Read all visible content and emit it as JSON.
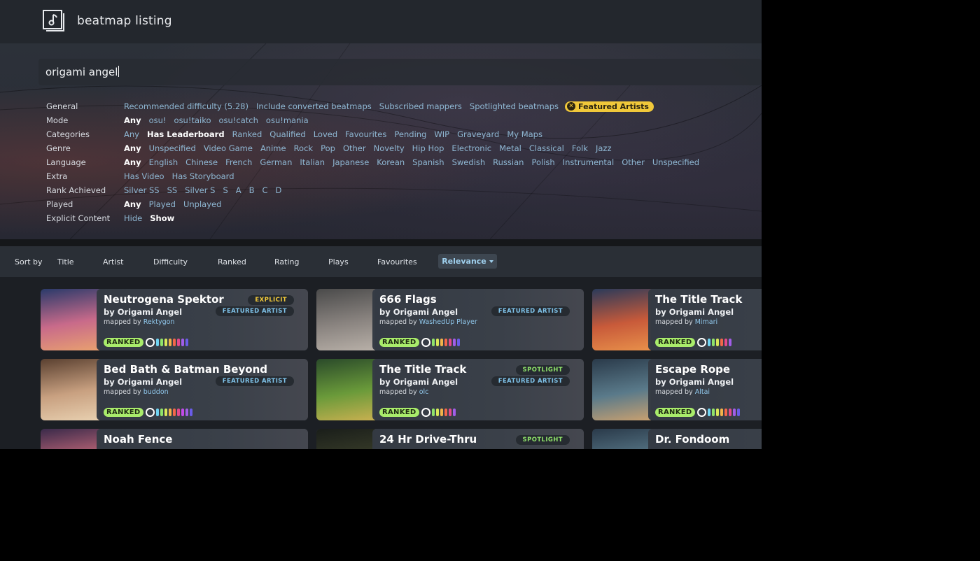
{
  "header": {
    "title": "beatmap listing",
    "logo_icon": "music-note-icon"
  },
  "search": {
    "value": "origami angel"
  },
  "filters": [
    {
      "label": "General",
      "options": [
        {
          "text": "Recommended difficulty (5.28)",
          "active": false
        },
        {
          "text": "Include converted beatmaps",
          "active": false
        },
        {
          "text": "Subscribed mappers",
          "active": false
        },
        {
          "text": "Spotlighted beatmaps",
          "active": false
        }
      ],
      "pill": "Featured Artists"
    },
    {
      "label": "Mode",
      "options": [
        {
          "text": "Any",
          "active": true
        },
        {
          "text": "osu!",
          "active": false
        },
        {
          "text": "osu!taiko",
          "active": false
        },
        {
          "text": "osu!catch",
          "active": false
        },
        {
          "text": "osu!mania",
          "active": false
        }
      ]
    },
    {
      "label": "Categories",
      "options": [
        {
          "text": "Any",
          "active": false
        },
        {
          "text": "Has Leaderboard",
          "active": true
        },
        {
          "text": "Ranked",
          "active": false
        },
        {
          "text": "Qualified",
          "active": false
        },
        {
          "text": "Loved",
          "active": false
        },
        {
          "text": "Favourites",
          "active": false
        },
        {
          "text": "Pending",
          "active": false
        },
        {
          "text": "WIP",
          "active": false
        },
        {
          "text": "Graveyard",
          "active": false
        },
        {
          "text": "My Maps",
          "active": false
        }
      ]
    },
    {
      "label": "Genre",
      "options": [
        {
          "text": "Any",
          "active": true
        },
        {
          "text": "Unspecified",
          "active": false
        },
        {
          "text": "Video Game",
          "active": false
        },
        {
          "text": "Anime",
          "active": false
        },
        {
          "text": "Rock",
          "active": false
        },
        {
          "text": "Pop",
          "active": false
        },
        {
          "text": "Other",
          "active": false
        },
        {
          "text": "Novelty",
          "active": false
        },
        {
          "text": "Hip Hop",
          "active": false
        },
        {
          "text": "Electronic",
          "active": false
        },
        {
          "text": "Metal",
          "active": false
        },
        {
          "text": "Classical",
          "active": false
        },
        {
          "text": "Folk",
          "active": false
        },
        {
          "text": "Jazz",
          "active": false
        }
      ]
    },
    {
      "label": "Language",
      "options": [
        {
          "text": "Any",
          "active": true
        },
        {
          "text": "English",
          "active": false
        },
        {
          "text": "Chinese",
          "active": false
        },
        {
          "text": "French",
          "active": false
        },
        {
          "text": "German",
          "active": false
        },
        {
          "text": "Italian",
          "active": false
        },
        {
          "text": "Japanese",
          "active": false
        },
        {
          "text": "Korean",
          "active": false
        },
        {
          "text": "Spanish",
          "active": false
        },
        {
          "text": "Swedish",
          "active": false
        },
        {
          "text": "Russian",
          "active": false
        },
        {
          "text": "Polish",
          "active": false
        },
        {
          "text": "Instrumental",
          "active": false
        },
        {
          "text": "Other",
          "active": false
        },
        {
          "text": "Unspecified",
          "active": false
        }
      ]
    },
    {
      "label": "Extra",
      "options": [
        {
          "text": "Has Video",
          "active": false
        },
        {
          "text": "Has Storyboard",
          "active": false
        }
      ]
    },
    {
      "label": "Rank Achieved",
      "options": [
        {
          "text": "Silver SS",
          "active": false
        },
        {
          "text": "SS",
          "active": false
        },
        {
          "text": "Silver S",
          "active": false
        },
        {
          "text": "S",
          "active": false
        },
        {
          "text": "A",
          "active": false
        },
        {
          "text": "B",
          "active": false
        },
        {
          "text": "C",
          "active": false
        },
        {
          "text": "D",
          "active": false
        }
      ]
    },
    {
      "label": "Played",
      "options": [
        {
          "text": "Any",
          "active": true
        },
        {
          "text": "Played",
          "active": false
        },
        {
          "text": "Unplayed",
          "active": false
        }
      ]
    },
    {
      "label": "Explicit Content",
      "options": [
        {
          "text": "Hide",
          "active": false
        },
        {
          "text": "Show",
          "active": true
        }
      ]
    }
  ],
  "sort": {
    "label": "Sort by",
    "options": [
      "Title",
      "Artist",
      "Difficulty",
      "Ranked",
      "Rating",
      "Plays",
      "Favourites"
    ],
    "active": "Relevance"
  },
  "cards": [
    {
      "title": "Neutrogena Spektor",
      "artist": "by Origami Angel",
      "mapped_by": "mapped by",
      "mapper": "Rektygon",
      "tags": [
        "EXPLICIT",
        "FEATURED ARTIST"
      ],
      "status": "RANKED",
      "diffs": [
        "#6fd3f2",
        "#8fe36a",
        "#d8e85a",
        "#f2b34a",
        "#f2674a",
        "#e54a8c",
        "#a15ee8",
        "#6a5ce8"
      ],
      "thumb": [
        "#2a3a6a",
        "#c86a8a",
        "#e8a070"
      ]
    },
    {
      "title": "666 Flags",
      "artist": "by Origami Angel",
      "mapped_by": "mapped by",
      "mapper": "WashedUp Player",
      "tags": [
        "FEATURED ARTIST"
      ],
      "status": "RANKED",
      "diffs": [
        "#8fe36a",
        "#d8e85a",
        "#f2b34a",
        "#f2674a",
        "#e54a8c",
        "#a15ee8",
        "#6a5ce8"
      ],
      "thumb": [
        "#4a4a4a",
        "#8a8480",
        "#b8b0a8"
      ]
    },
    {
      "title": "The Title Track",
      "artist": "by Origami Angel",
      "mapped_by": "mapped by",
      "mapper": "Mimari",
      "tags": [],
      "status": "RANKED",
      "diffs": [
        "#6fd3f2",
        "#8fe36a",
        "#d8e85a",
        "#f2674a",
        "#e54a8c",
        "#a15ee8"
      ],
      "thumb": [
        "#2a3a5a",
        "#c85a3a",
        "#e8904a"
      ]
    },
    {
      "title": "Bed Bath & Batman Beyond",
      "artist": "by Origami Angel",
      "mapped_by": "mapped by",
      "mapper": "buddon",
      "tags": [
        "FEATURED ARTIST"
      ],
      "status": "RANKED",
      "diffs": [
        "#6fd3f2",
        "#8fe36a",
        "#d8e85a",
        "#f2b34a",
        "#f2674a",
        "#e54a8c",
        "#c24ae8",
        "#a15ee8",
        "#6a5ce8"
      ],
      "thumb": [
        "#5a4030",
        "#c8a080",
        "#e8d0b0"
      ]
    },
    {
      "title": "The Title Track",
      "artist": "by Origami Angel",
      "mapped_by": "mapped by",
      "mapper": "olc",
      "tags": [
        "SPOTLIGHT",
        "FEATURED ARTIST"
      ],
      "status": "RANKED",
      "diffs": [
        "#8fe36a",
        "#d8e85a",
        "#f2b34a",
        "#f2674a",
        "#e54a8c",
        "#a15ee8"
      ],
      "thumb": [
        "#2a4a2a",
        "#6a9a3a",
        "#c8b050"
      ]
    },
    {
      "title": "Escape Rope",
      "artist": "by Origami Angel",
      "mapped_by": "mapped by",
      "mapper": "Altai",
      "tags": [],
      "status": "RANKED",
      "diffs": [
        "#6fd3f2",
        "#8fe36a",
        "#d8e85a",
        "#f2b34a",
        "#f2674a",
        "#e54a8c",
        "#a15ee8",
        "#6a5ce8"
      ],
      "thumb": [
        "#2a3a4a",
        "#5a7a8a",
        "#c8a070"
      ]
    },
    {
      "title": "Noah Fence",
      "artist": "",
      "mapped_by": "",
      "mapper": "",
      "tags": [],
      "status": "",
      "diffs": [],
      "thumb": [
        "#3a2a4a",
        "#c86a7a",
        "#e8a070"
      ]
    },
    {
      "title": "24 Hr Drive-Thru",
      "artist": "",
      "mapped_by": "",
      "mapper": "",
      "tags": [
        "SPOTLIGHT"
      ],
      "status": "",
      "diffs": [],
      "thumb": [
        "#1a1e1a",
        "#3a3e2a",
        "#5a5a3a"
      ]
    },
    {
      "title": "Dr. Fondoom",
      "artist": "",
      "mapped_by": "",
      "mapper": "",
      "tags": [],
      "status": "",
      "diffs": [],
      "thumb": [
        "#2a3a4a",
        "#5a7a8a",
        "#8aa0b0"
      ]
    }
  ]
}
